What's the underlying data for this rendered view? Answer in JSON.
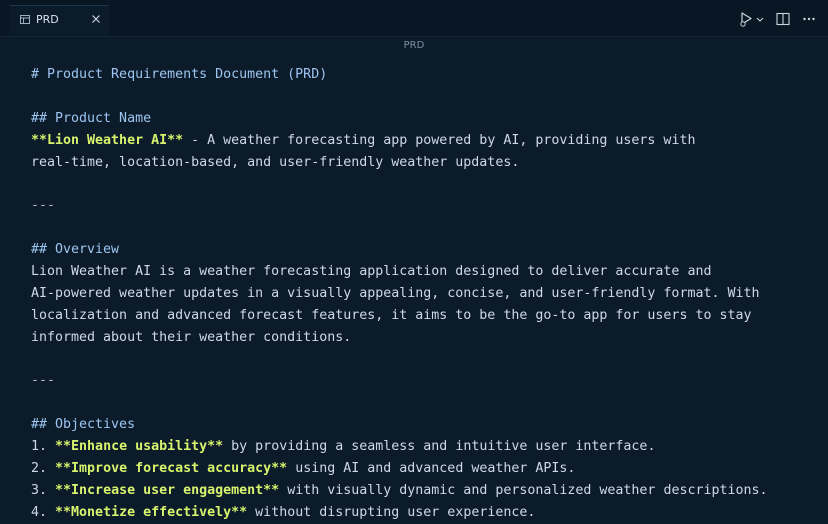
{
  "tab": {
    "label": "PRD"
  },
  "breadcrumb": "PRD",
  "document": {
    "title_heading": "# Product Requirements Document (PRD)",
    "product_name_heading": "## Product Name",
    "product_name_bold": "**Lion Weather AI**",
    "product_name_text_1": " - A weather forecasting app powered by AI, providing users with",
    "product_name_text_2": "real-time, location-based, and user-friendly weather updates.",
    "hr_1": "---",
    "overview_heading": "## Overview",
    "overview_lines": [
      "Lion Weather AI is a weather forecasting application designed to deliver accurate and",
      "AI-powered weather updates in a visually appealing, concise, and user-friendly format. With",
      "localization and advanced forecast features, it aims to be the go-to app for users to stay",
      "informed about their weather conditions."
    ],
    "hr_2": "---",
    "objectives_heading": "## Objectives",
    "objectives": [
      {
        "num": "1. ",
        "bold": "**Enhance usability**",
        "text": " by providing a seamless and intuitive user interface."
      },
      {
        "num": "2. ",
        "bold": "**Improve forecast accuracy**",
        "text": " using AI and advanced weather APIs."
      },
      {
        "num": "3. ",
        "bold": "**Increase user engagement**",
        "text": " with visually dynamic and personalized weather descriptions."
      },
      {
        "num": "4. ",
        "bold": "**Monetize effectively**",
        "text": " without disrupting user experience."
      }
    ]
  },
  "icons": {
    "file": "file-preview-icon",
    "close": "close-icon",
    "run": "run-icon",
    "split": "split-editor-icon"
  }
}
